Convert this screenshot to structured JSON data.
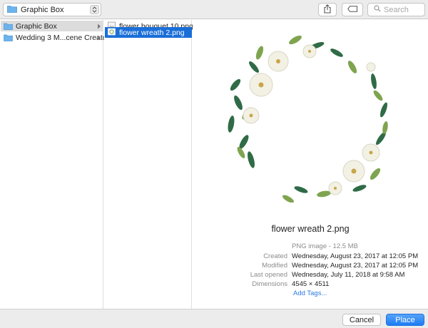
{
  "toolbar": {
    "location": "Graphic Box",
    "search_placeholder": "Search",
    "share_icon": "share-icon",
    "tag_icon": "tag-icon"
  },
  "sidebar_column": {
    "items": [
      {
        "label": "Graphic Box",
        "state": "selected-inactive",
        "icon": "folder-icon"
      },
      {
        "label": "Wedding 3 M...cene Creator",
        "state": "normal",
        "icon": "folder-icon"
      }
    ]
  },
  "file_column": {
    "items": [
      {
        "label": "flower bouquet 10.png",
        "state": "normal",
        "icon": "image-file-icon"
      },
      {
        "label": "flower wreath 2.png",
        "state": "selected",
        "icon": "image-file-icon"
      }
    ]
  },
  "preview": {
    "filename": "flower wreath 2.png",
    "kind": "PNG image - 12.5 MB",
    "fields": [
      {
        "key": "Created",
        "value": "Wednesday, August 23, 2017 at 12:05 PM"
      },
      {
        "key": "Modified",
        "value": "Wednesday, August 23, 2017 at 12:05 PM"
      },
      {
        "key": "Last opened",
        "value": "Wednesday, July 11, 2018 at 9:58 AM"
      },
      {
        "key": "Dimensions",
        "value": "4545 × 4511"
      }
    ],
    "add_tags": "Add Tags..."
  },
  "footer": {
    "cancel_label": "Cancel",
    "place_label": "Place"
  },
  "colors": {
    "accent": "#1a6ed8",
    "folder": "#6db3ec",
    "link": "#2a7ae2",
    "leaf_dark": "#2f6b46",
    "leaf_light": "#7fa450",
    "flower": "#f3f1e4"
  }
}
